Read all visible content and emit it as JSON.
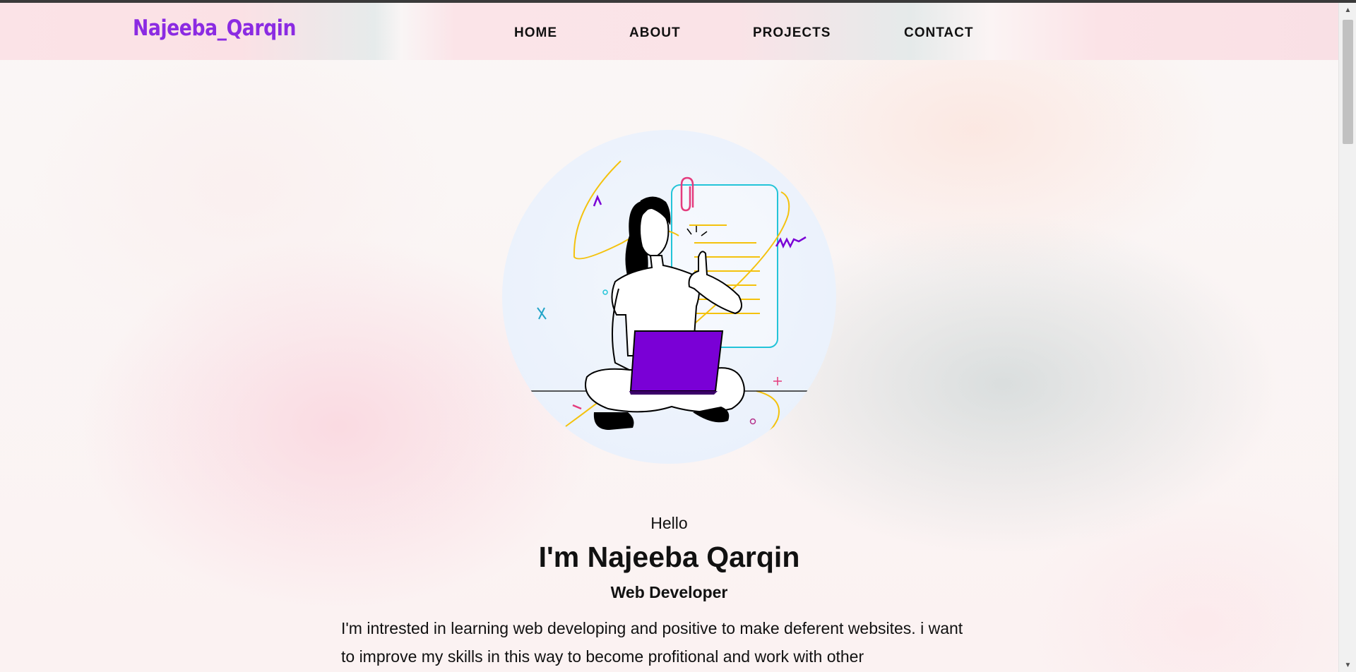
{
  "brand": {
    "logo_text": "Najeeba_Qarqin",
    "color": "#8b2be2"
  },
  "nav": {
    "items": [
      {
        "label": "HOME"
      },
      {
        "label": "ABOUT"
      },
      {
        "label": "PROJECTS"
      },
      {
        "label": "CONTACT"
      }
    ]
  },
  "hero": {
    "illustration": "woman-with-laptop-illustration",
    "laptop_color": "#7a00d6",
    "greeting": "Hello",
    "headline": "I'm Najeeba Qarqin",
    "role": "Web Developer",
    "intro": "I'm intrested in learning web developing and positive to make deferent websites. i want to improve my skills in this way to become profitional and work with other"
  }
}
